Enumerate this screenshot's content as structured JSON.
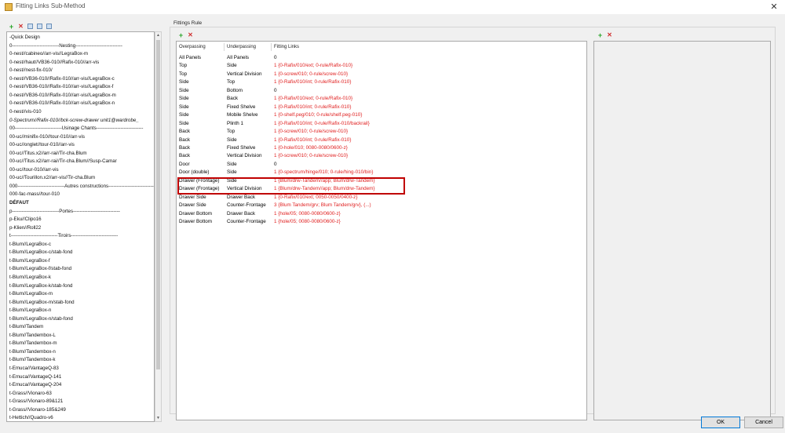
{
  "window": {
    "title": "Fitting Links Sub-Method",
    "close_glyph": "✕"
  },
  "left_toolbar": {
    "add": "+",
    "delete": "✕"
  },
  "left_list": {
    "items": [
      {
        "text": "-Quick Design",
        "style": ""
      },
      {
        "text": "0-----------------------------Nesting-----------------------------",
        "style": ""
      },
      {
        "text": "0-nest//cabineo//arr-vis//LegraBox-m",
        "style": ""
      },
      {
        "text": "0-nest//haut//VB36-010//Rafix-010//arr-vis",
        "style": ""
      },
      {
        "text": "0-nest//nest-fix-010/",
        "style": ""
      },
      {
        "text": "0-nest//VB36-010//Rafix-010//arr-vis//LegraBox-c",
        "style": ""
      },
      {
        "text": "0-nest//VB36-010//Rafix-010//arr-vis//LegraBox-f",
        "style": ""
      },
      {
        "text": "0-nest//VB36-010//Rafix-010//arr-vis//LegraBox-m",
        "style": ""
      },
      {
        "text": "0-nest//VB36-010//Rafix-010//arr-vis//LegraBox-n",
        "style": ""
      },
      {
        "text": "0-nest//vis-010",
        "style": ""
      },
      {
        "text": "0-Spectrum//Rafix-010//bck-screw-drawer unit1@wardrobe_",
        "style": "italic"
      },
      {
        "text": "00-----------------------------Usinage Chants-----------------------------",
        "style": ""
      },
      {
        "text": "00-uc//minifix-010//tour-010//arr-vis",
        "style": ""
      },
      {
        "text": "00-uc//onglet//tour-010//arr-vis",
        "style": ""
      },
      {
        "text": "00-uc//Titus.x2//arr-rai//Tir-cha.Blum",
        "style": ""
      },
      {
        "text": "00-uc//Titus.x2//arr-rai//Tir-cha.Blum//Susp-Camar",
        "style": ""
      },
      {
        "text": "00-uc//tour-010//arr-vis",
        "style": ""
      },
      {
        "text": "00-uc//Tourillon.x2//arr-vis//Tir-cha.Blum",
        "style": ""
      },
      {
        "text": "000-----------------------------Autres constructions-----------------------------",
        "style": ""
      },
      {
        "text": "000-fac-mass//tour-010",
        "style": ""
      },
      {
        "text": "DÉFAUT",
        "style": "bold"
      },
      {
        "text": "p-----------------------------Portes-----------------------------",
        "style": ""
      },
      {
        "text": "p-Eku//Clipo16",
        "style": ""
      },
      {
        "text": "p-Klien//Roll22",
        "style": ""
      },
      {
        "text": "t-----------------------------Tiroirs-----------------------------",
        "style": ""
      },
      {
        "text": "t-Blum//LegraBox-c",
        "style": ""
      },
      {
        "text": "t-Blum//LegraBox-c/stab-fond",
        "style": ""
      },
      {
        "text": "t-Blum//LegraBox-f",
        "style": ""
      },
      {
        "text": "t-Blum//LegraBox-f/stab-fond",
        "style": ""
      },
      {
        "text": "t-Blum//LegraBox-k",
        "style": ""
      },
      {
        "text": "t-Blum//LegraBox-k/stab-fond",
        "style": ""
      },
      {
        "text": "t-Blum//LegraBox-m",
        "style": ""
      },
      {
        "text": "t-Blum//LegraBox-m/stab-fond",
        "style": ""
      },
      {
        "text": "t-Blum//LegraBox-n",
        "style": ""
      },
      {
        "text": "t-Blum//LegraBox-n/stab-fond",
        "style": ""
      },
      {
        "text": "t-Blum//Tandem",
        "style": ""
      },
      {
        "text": "t-Blum//Tandembox-L",
        "style": ""
      },
      {
        "text": "t-Blum//Tandembox-m",
        "style": ""
      },
      {
        "text": "t-Blum//Tandembox-n",
        "style": ""
      },
      {
        "text": "t-Blum//Tandembox-k",
        "style": ""
      },
      {
        "text": "t-Emuca//VantageQ-83",
        "style": ""
      },
      {
        "text": "t-Emuca//VantageQ-141",
        "style": ""
      },
      {
        "text": "t-Emuca//VantageQ-204",
        "style": ""
      },
      {
        "text": "t-Grass//Vionaro-63",
        "style": ""
      },
      {
        "text": "t-Grass//Vionaro-89&121",
        "style": ""
      },
      {
        "text": "t-Grass//Vionaro-185&249",
        "style": ""
      },
      {
        "text": "t-Hettich//Quadro-v6",
        "style": ""
      }
    ]
  },
  "fittings_rule": {
    "group_label": "Fittings Rule",
    "add": "+",
    "delete": "✕",
    "headers": {
      "overpassing": "Overpassing",
      "underpassing": "Underpassing",
      "fitting_links": "Fitting Links"
    },
    "rows": [
      {
        "over": "All Panels",
        "under": "All Panels",
        "links": "0",
        "red": false
      },
      {
        "over": "Top",
        "under": "Side",
        "links": "1 {0-Rafix/010/ext; 0-rule/Rafix-010}",
        "red": true
      },
      {
        "over": "Top",
        "under": "Vertical Division",
        "links": "1 {0-screw/010; 0-rule/screw-010}",
        "red": true
      },
      {
        "over": "Side",
        "under": "Top",
        "links": "1 {0-Rafix/010/int; 0-rule/Rafix-010}",
        "red": true
      },
      {
        "over": "Side",
        "under": "Bottom",
        "links": "0",
        "red": false
      },
      {
        "over": "Side",
        "under": "Back",
        "links": "1 {0-Rafix/010/ext; 0-rule/Rafix-010}",
        "red": true
      },
      {
        "over": "Side",
        "under": "Fixed Shelve",
        "links": "1 {0-Rafix/010/int; 0-rule/Rafix-010}",
        "red": true
      },
      {
        "over": "Side",
        "under": "Mobile Shelve",
        "links": "1 {0-shelf.peg/010; 0-rule/shelf.peg-010}",
        "red": true
      },
      {
        "over": "Side",
        "under": "Plinth 1",
        "links": "1 {0-Rafix/010/int; 0-rule/Rafix-010/backrail}",
        "red": true
      },
      {
        "over": "Back",
        "under": "Top",
        "links": "1 {0-screw/010; 0-rule/screw-010}",
        "red": true
      },
      {
        "over": "Back",
        "under": "Side",
        "links": "1 {0-Rafix/010/int; 0-rule/Rafix-010}",
        "red": true
      },
      {
        "over": "Back",
        "under": "Fixed Shelve",
        "links": "1 {0-hole/010; 0080-0080/0600-z}",
        "red": true
      },
      {
        "over": "Back",
        "under": "Vertical Division",
        "links": "1 {0-screw/010; 0-rule/screw-010}",
        "red": true
      },
      {
        "over": "Door",
        "under": "Side",
        "links": "0",
        "red": false
      },
      {
        "over": "Door (double)",
        "under": "Side",
        "links": "1 {0-spectrum/hinge/010; 0-rule/hing-010/bin}",
        "red": true
      },
      {
        "over": "Drawer (Frontage)",
        "under": "Side",
        "links": "1 {Blum/drw-Tandem//app; Blum/drw-Tandem}",
        "red": true
      },
      {
        "over": "Drawer (Frontage)",
        "under": "Vertical Division",
        "links": "1 {Blum/drw-Tandem//app; Blum/drw-Tandem}",
        "red": true
      },
      {
        "over": "Drawer Side",
        "under": "Drawer Back",
        "links": "1 {0-Rafix/010/ext; 0050-0050/0400-z}",
        "red": true
      },
      {
        "over": "Drawer Side",
        "under": "Counter-Frontage",
        "links": "3 {Blum Tandem/grv; Blum Tandem/grv}, (...)",
        "red": true
      },
      {
        "over": "Drawer Bottom",
        "under": "Drawer Back",
        "links": "1 {hole/05; 0080-0080/0600-z}",
        "red": true
      },
      {
        "over": "Drawer Bottom",
        "under": "Counter-Frontage",
        "links": "1 {hole/05; 0080-0080/0600-z}",
        "red": true
      }
    ]
  },
  "right_toolbar": {
    "add": "+",
    "delete": "✕"
  },
  "buttons": {
    "ok": "OK",
    "cancel": "Cancel"
  },
  "colors": {
    "link_red": "#e02020",
    "highlight": "#c00000",
    "add_green": "#2aa52a"
  }
}
